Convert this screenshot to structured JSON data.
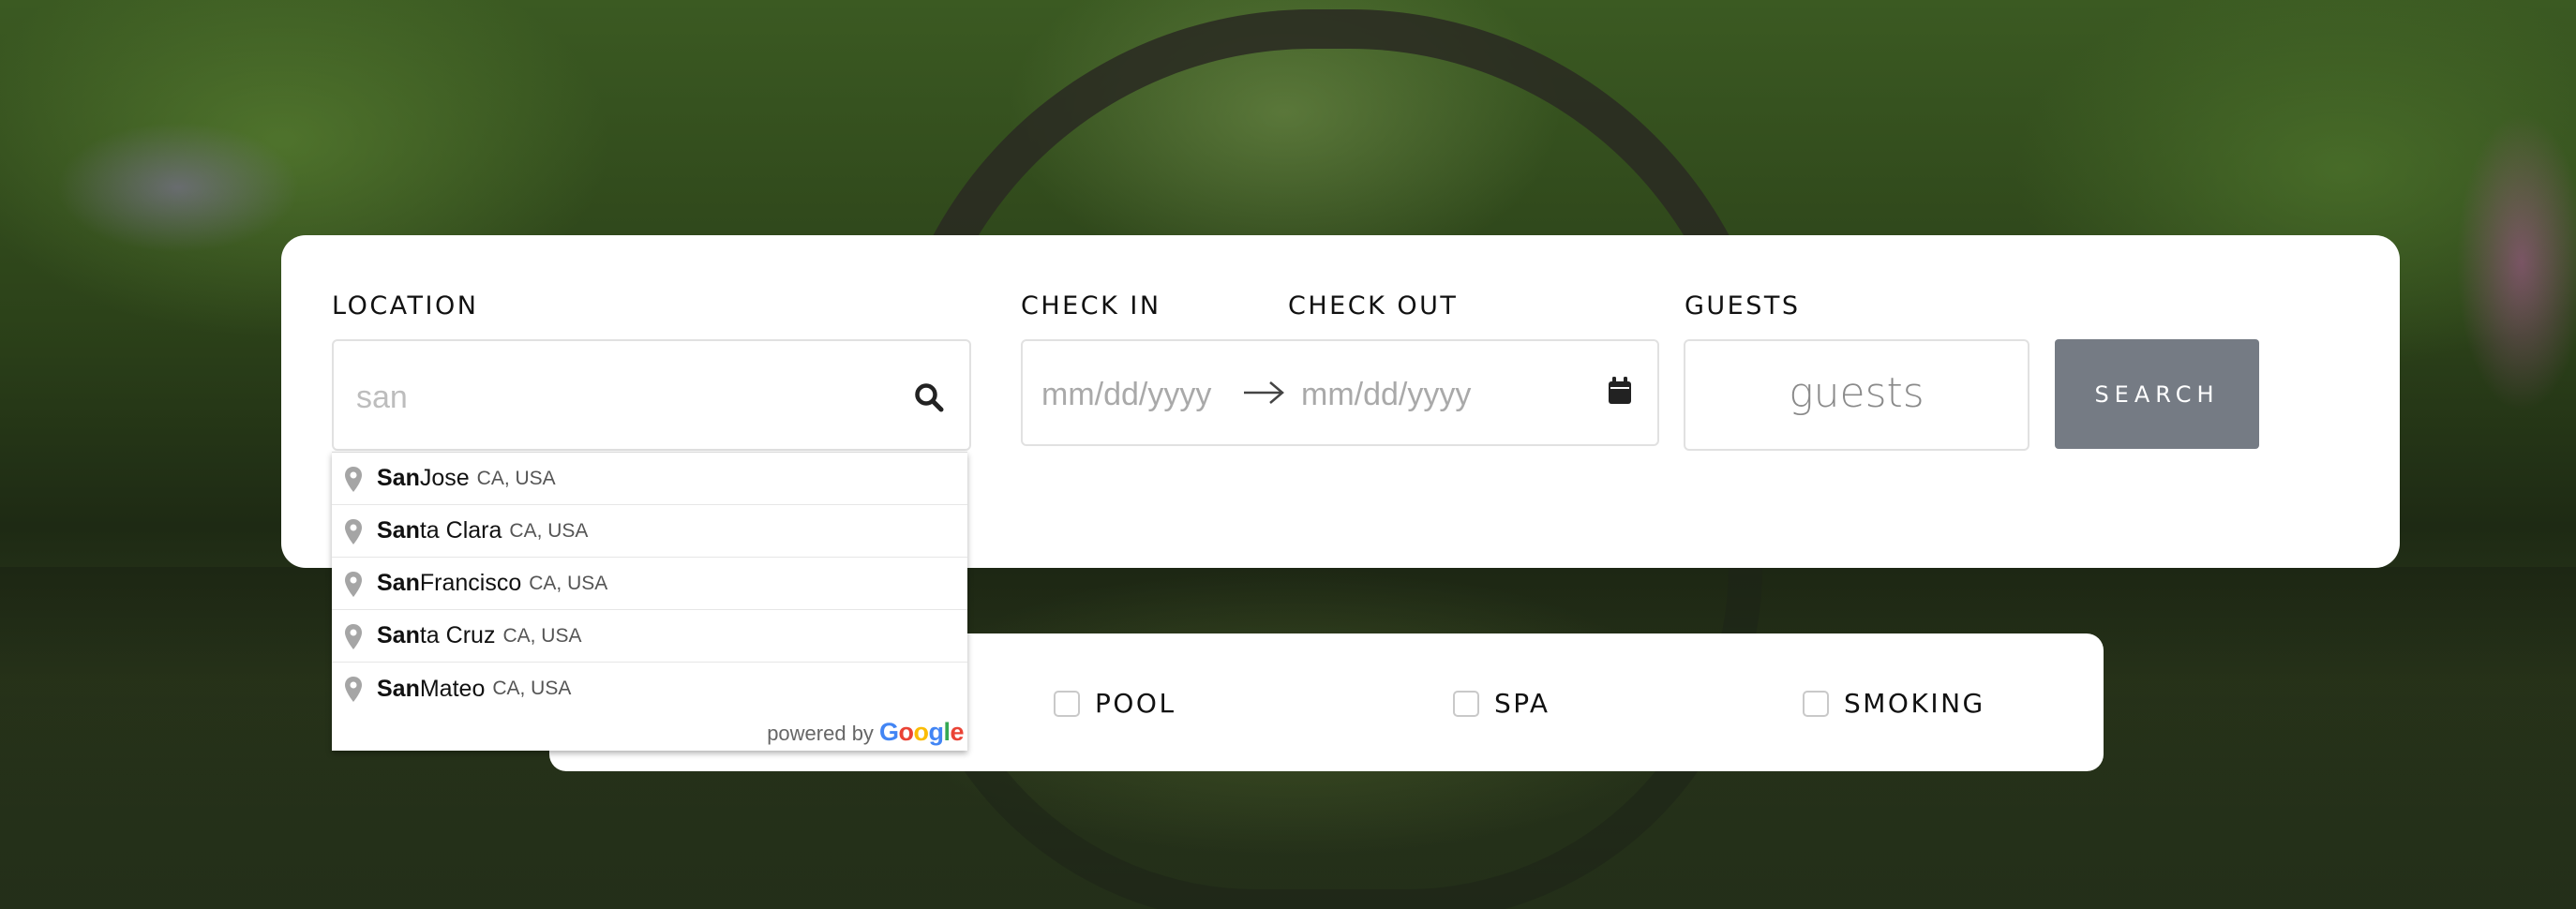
{
  "colors": {
    "card_bg": "#ffffff",
    "search_button_bg": "#757b84",
    "input_border": "#e1e1e1",
    "placeholder_text": "#a9a9a9"
  },
  "form": {
    "location": {
      "label": "LOCATION",
      "value": "san",
      "icon": "search-icon"
    },
    "dates": {
      "check_in_label": "CHECK IN",
      "check_out_label": "CHECK OUT",
      "check_in_placeholder": "mm/dd/yyyy",
      "check_out_placeholder": "mm/dd/yyyy",
      "arrow_icon": "arrow-right-icon",
      "calendar_icon": "calendar-icon"
    },
    "guests": {
      "label": "GUESTS",
      "placeholder": "guests"
    },
    "search_button": "SEARCH"
  },
  "amenities": [
    {
      "label": "POOL",
      "checked": false
    },
    {
      "label": "SPA",
      "checked": false
    },
    {
      "label": "SMOKING",
      "checked": false
    }
  ],
  "autocomplete": {
    "suggestions": [
      {
        "match": "San",
        "rest": " Jose",
        "secondary": "CA, USA"
      },
      {
        "match": "San",
        "rest": "ta Clara",
        "secondary": "CA, USA"
      },
      {
        "match": "San",
        "rest": " Francisco",
        "secondary": "CA, USA"
      },
      {
        "match": "San",
        "rest": "ta Cruz",
        "secondary": "CA, USA"
      },
      {
        "match": "San",
        "rest": " Mateo",
        "secondary": "CA, USA"
      }
    ],
    "pin_icon": "map-pin-icon",
    "powered_by": "powered by",
    "brand": "Google"
  }
}
